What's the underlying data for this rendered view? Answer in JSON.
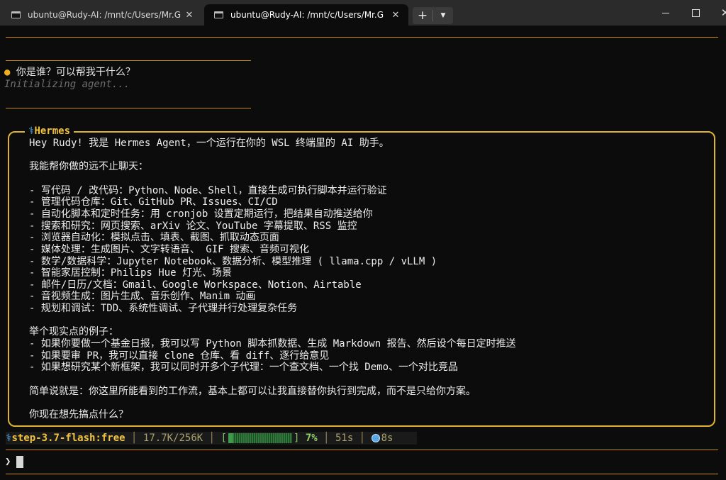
{
  "window": {
    "tabs": [
      {
        "title": "ubuntu@Rudy-AI: /mnt/c/Users/Mr.G",
        "close": "✕"
      },
      {
        "title": "ubuntu@Rudy-AI: /mnt/c/Users/Mr.G",
        "close": "✕"
      }
    ],
    "new_tab": "+",
    "dropdown": "⌄",
    "controls": {
      "close": "✕"
    }
  },
  "session": {
    "user_bullet": "●",
    "user_message": "你是谁？可以帮我干什么？",
    "status": "Initializing agent..."
  },
  "hermes": {
    "icon": "⚕",
    "label": "Hermes",
    "lines": [
      "Hey Rudy! 我是 Hermes Agent，一个运行在你的 WSL 终端里的 AI 助手。",
      "",
      "我能帮你做的远不止聊天：",
      "",
      "- 写代码 / 改代码：Python、Node、Shell，直接生成可执行脚本并运行验证",
      "- 管理代码仓库：Git、GitHub PR、Issues、CI/CD",
      "- 自动化脚本和定时任务：用 cronjob 设置定期运行，把结果自动推送给你",
      "- 搜索和研究：网页搜索、arXiv 论文、YouTube 字幕提取、RSS 监控",
      "- 浏览器自动化：模拟点击、填表、截图、抓取动态页面",
      "- 媒体处理：生成图片、文字转语音、 GIF 搜索、音频可视化",
      "- 数学/数据科学：Jupyter Notebook、数据分析、模型推理 ( llama.cpp / vLLM )",
      "- 智能家居控制：Philips Hue 灯光、场景",
      "- 邮件/日历/文档：Gmail、Google Workspace、Notion、Airtable",
      "- 音视频生成：图片生成、音乐创作、Manim 动画",
      "- 规划和调试：TDD、系统性调试、子代理并行处理复杂任务",
      "",
      "举个现实点的例子：",
      "- 如果你要做一个基金日报，我可以写 Python 脚本抓数据、生成 Markdown 报告、然后设个每日定时推送",
      "- 如果要审 PR，我可以直接 clone 仓库、看 diff、逐行给意见",
      "- 如果想研究某个新框架，我可以同时开多个子代理：一个查文档、一个找 Demo、一个对比竞品",
      "",
      "简单说就是：你这里所能看到的工作流，基本上都可以让我直接替你执行到完成，而不是只给你方案。",
      "",
      "你现在想先搞点什么？"
    ]
  },
  "statusbar": {
    "model_icon": "⚕",
    "model": "step-3.7-flash:free",
    "sep": "│",
    "tokens": "17.7K/256K",
    "bar_open": "[",
    "bar_close": "]",
    "context_percent": 7,
    "percent": "7%",
    "elapsed": "51s",
    "timer": "8s"
  },
  "input": {
    "prompt": "❯"
  },
  "colors": {
    "accent": "#e0b330",
    "rule": "#c98a1b",
    "progress": "#2f7a3a",
    "link_icon": "#4fb4ff"
  }
}
